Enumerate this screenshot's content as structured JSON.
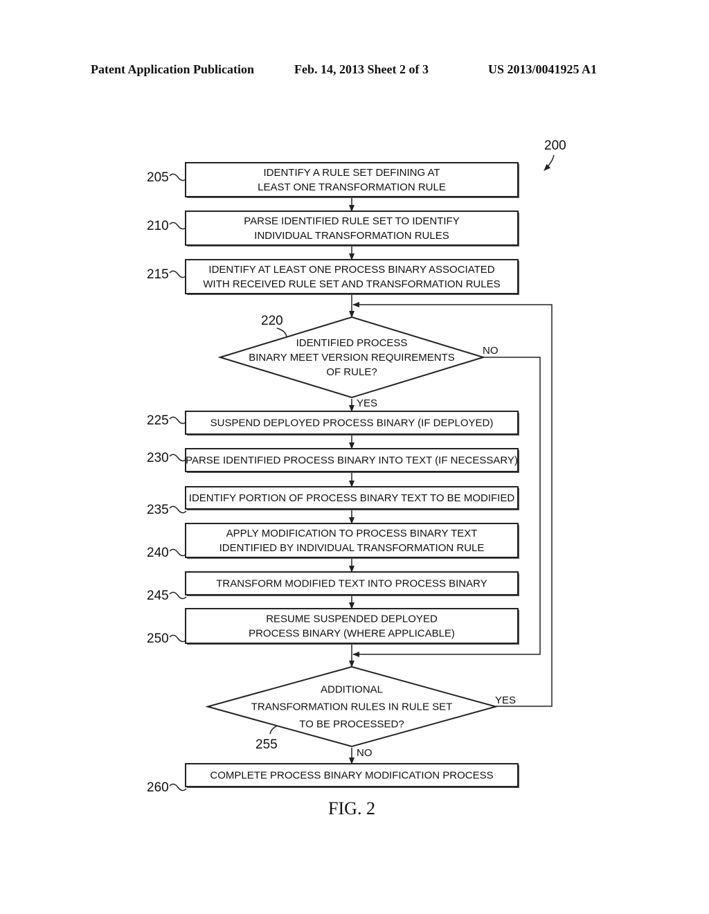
{
  "header": {
    "publication": "Patent Application Publication",
    "date_sheet": "Feb. 14, 2013   Sheet 2 of 3",
    "number": "US 2013/0041925 A1"
  },
  "figure": {
    "ref": "200",
    "caption": "FIG. 2",
    "steps": [
      {
        "ref": "205",
        "lines": [
          "IDENTIFY A RULE SET DEFINING AT",
          "LEAST ONE TRANSFORMATION RULE"
        ]
      },
      {
        "ref": "210",
        "lines": [
          "PARSE IDENTIFIED RULE SET TO IDENTIFY",
          "INDIVIDUAL TRANSFORMATION RULES"
        ]
      },
      {
        "ref": "215",
        "lines": [
          "IDENTIFY AT LEAST ONE PROCESS BINARY ASSOCIATED",
          "WITH RECEIVED RULE SET AND TRANSFORMATION RULES"
        ]
      },
      {
        "ref": "225",
        "lines": [
          "SUSPEND DEPLOYED PROCESS BINARY (IF DEPLOYED)"
        ]
      },
      {
        "ref": "230",
        "lines": [
          "PARSE IDENTIFIED PROCESS BINARY INTO TEXT (IF NECESSARY)"
        ]
      },
      {
        "ref": "235",
        "lines": [
          "IDENTIFY PORTION OF PROCESS BINARY TEXT TO BE MODIFIED"
        ]
      },
      {
        "ref": "240",
        "lines": [
          "APPLY MODIFICATION TO PROCESS BINARY TEXT",
          "IDENTIFIED BY INDIVIDUAL TRANSFORMATION RULE"
        ]
      },
      {
        "ref": "245",
        "lines": [
          "TRANSFORM MODIFIED TEXT INTO PROCESS BINARY"
        ]
      },
      {
        "ref": "250",
        "lines": [
          "RESUME SUSPENDED DEPLOYED",
          "PROCESS BINARY (WHERE APPLICABLE)"
        ]
      },
      {
        "ref": "260",
        "lines": [
          "COMPLETE PROCESS BINARY MODIFICATION PROCESS"
        ]
      }
    ],
    "decisions": [
      {
        "ref": "220",
        "lines": [
          "IDENTIFIED PROCESS",
          "BINARY MEET VERSION REQUIREMENTS",
          "OF RULE?"
        ],
        "yes": "YES",
        "no": "NO"
      },
      {
        "ref": "255",
        "lines": [
          "ADDITIONAL",
          "TRANSFORMATION RULES IN RULE SET",
          "TO BE PROCESSED?"
        ],
        "yes": "YES",
        "no": "NO"
      }
    ]
  }
}
